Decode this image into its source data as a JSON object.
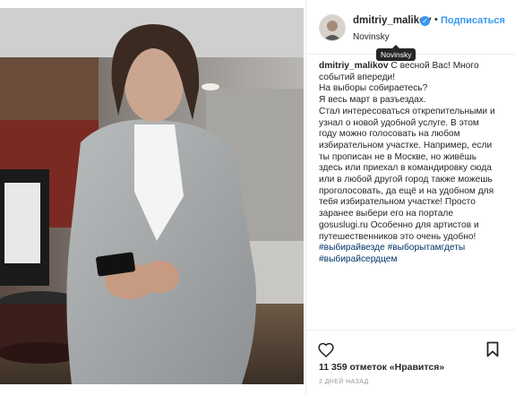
{
  "post": {
    "username": "dmitriy_malikov",
    "follow_label": "Подписаться",
    "separator": "•",
    "location": "Novinsky",
    "tooltip": "Novinsky",
    "caption_lines": [
      "С весной Вас! Много",
      "событий впереди!",
      "На выборы собираетесь?",
      "Я весь март в разъездах.",
      "Стал интересоваться открепительными и",
      "узнал о новой удобной услуге. В этом",
      "году можно голосовать на любом",
      "избирательном участке. Например, если",
      "ты прописан не в Москве, но живёшь",
      "здесь или приехал в командировку сюда",
      "или в любой другой город также можешь",
      "проголосовать, да ещё и на удобном для",
      "тебя избирательном участке! Просто",
      "заранее выбери его на портале",
      "gosuslugi.ru Особенно для артистов и",
      "путешественников это очень удобно!"
    ],
    "hashtags_line1": "#выбирайвезде #выборытамгдеты",
    "hashtags_line2": "#выбирайсердцем",
    "likes": "11 359 отметок «Нравится»",
    "time_ago": "2 ДНЕЙ НАЗАД"
  },
  "icons": {
    "verified": "verified-badge-icon",
    "like": "heart-icon",
    "save": "bookmark-icon"
  },
  "colors": {
    "accent": "#3897f0",
    "hashtag": "#003569",
    "muted": "#999999",
    "text": "#262626"
  }
}
